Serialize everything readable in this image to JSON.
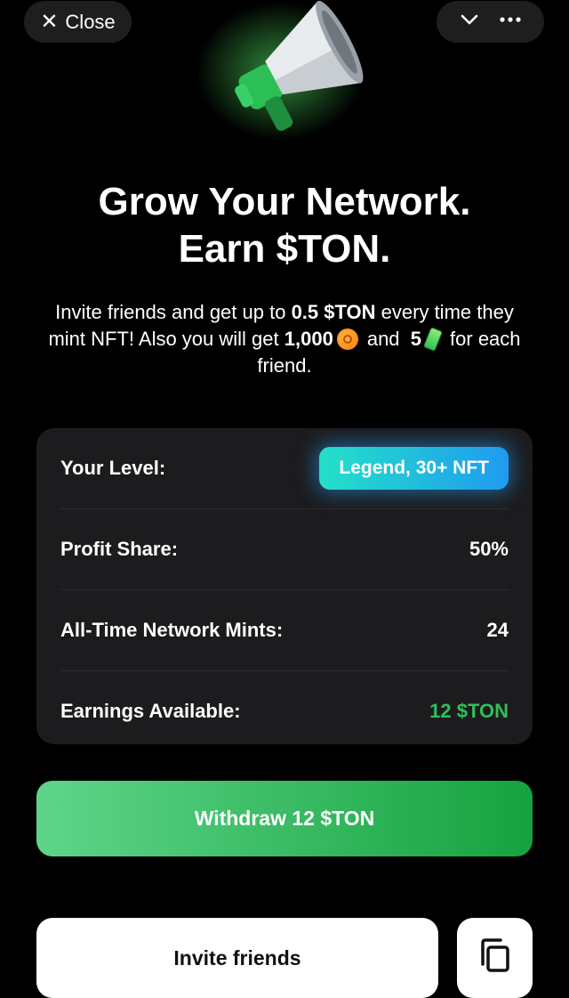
{
  "topbar": {
    "close_label": "Close",
    "close_icon": "close-x",
    "collapse_icon": "chevron-down",
    "more_icon": "more-dots"
  },
  "hero": {
    "icon": "megaphone",
    "accent": "#2fbf5a"
  },
  "headline": {
    "line1": "Grow Your Network.",
    "line2": "Earn $TON."
  },
  "intro": {
    "pre": "Invite friends and get up to ",
    "amount": "0.5 $TON",
    "mid": " every time they mint NFT! Also you will get ",
    "coins": "1,000",
    "and": "and",
    "energy": "5",
    "post": "for each friend."
  },
  "stats": {
    "level_label": "Your Level:",
    "level_value": "Legend, 30+ NFT",
    "profit_label": "Profit Share:",
    "profit_value": "50%",
    "mints_label": "All-Time Network Mints:",
    "mints_value": "24",
    "earnings_label": "Earnings Available:",
    "earnings_value": "12 $TON"
  },
  "actions": {
    "withdraw_label": "Withdraw 12 $TON",
    "invite_label": "Invite friends",
    "copy_icon": "copy"
  },
  "colors": {
    "background": "#000000",
    "card": "#1c1c1e",
    "green": "#2fbf5a",
    "badge_start": "#24e0c8",
    "badge_end": "#1f9bf0"
  }
}
